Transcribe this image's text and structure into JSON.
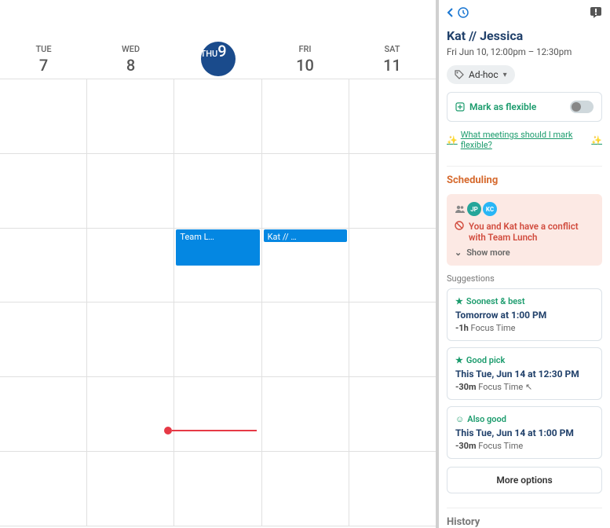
{
  "calendar": {
    "days": [
      {
        "dow": "TUE",
        "num": "7",
        "today": false
      },
      {
        "dow": "WED",
        "num": "8",
        "today": false
      },
      {
        "dow": "THU",
        "num": "9",
        "today": true
      },
      {
        "dow": "FRI",
        "num": "10",
        "today": false
      },
      {
        "dow": "SAT",
        "num": "11",
        "today": false
      }
    ],
    "events": {
      "team_lunch": "Team L…",
      "kat_jessica": "Kat // …"
    }
  },
  "panel": {
    "title": "Kat // Jessica",
    "time": "Fri Jun 10, 12:00pm – 12:30pm",
    "tag": "Ad-hoc",
    "flex_label": "Mark as flexible",
    "hint_link": "What meetings should I mark flexible?",
    "scheduling_header": "Scheduling",
    "avatars": {
      "jp": "JP",
      "kc": "KC"
    },
    "conflict_msg": "You and Kat have a conflict with Team Lunch",
    "show_more": "Show more",
    "suggestions_label": "Suggestions",
    "suggestions": [
      {
        "tag": "Soonest & best",
        "title": "Tomorrow at 1:00 PM",
        "delta": "-1h",
        "detail": "Focus Time",
        "icon": "star"
      },
      {
        "tag": "Good pick",
        "title": "This Tue, Jun 14 at 12:30 PM",
        "delta": "-30m",
        "detail": "Focus Time",
        "icon": "star"
      },
      {
        "tag": "Also good",
        "title": "This Tue, Jun 14 at 1:00 PM",
        "delta": "-30m",
        "detail": "Focus Time",
        "icon": "smile"
      }
    ],
    "more_options": "More options",
    "history_header": "History"
  }
}
